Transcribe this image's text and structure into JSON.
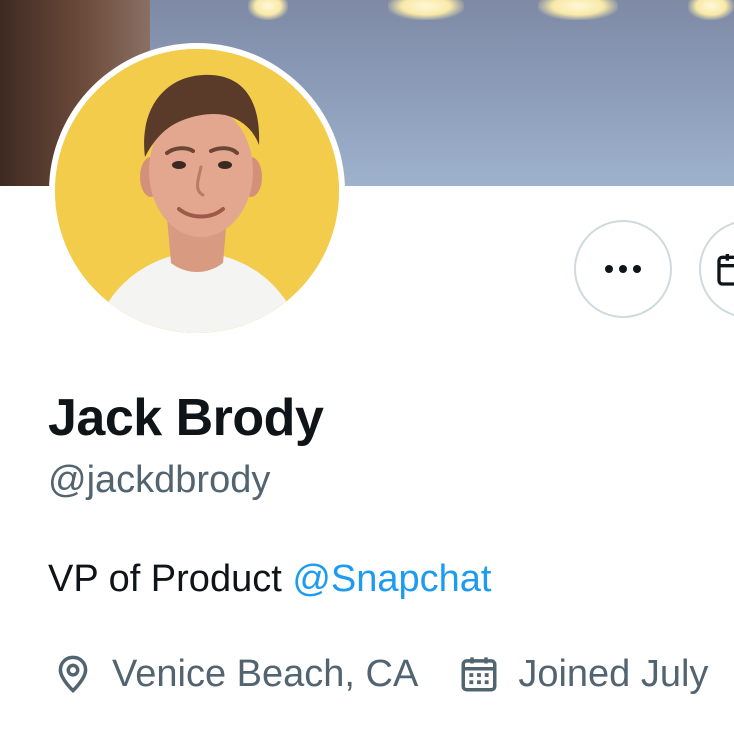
{
  "profile": {
    "name": "Jack Brody",
    "handle": "@jackdbrody",
    "bio": {
      "text": "VP of Product ",
      "mention": "@Snapchat"
    },
    "location": "Venice Beach, CA",
    "joined": "Joined July"
  },
  "icons": {
    "more": "more-horizontal-icon",
    "calendar": "calendar-icon",
    "location": "location-pin-icon"
  },
  "colors": {
    "text_primary": "#0f1419",
    "text_secondary": "#536471",
    "link": "#1d9bf0",
    "button_border": "#cfd9de",
    "avatar_background": "#f2cc4a"
  }
}
